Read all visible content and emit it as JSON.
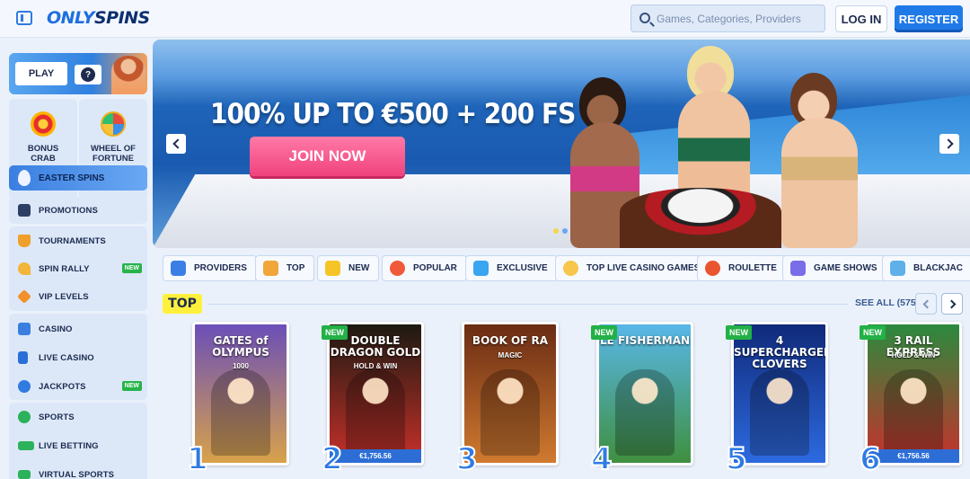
{
  "header": {
    "logo_main": "ONLY",
    "logo_accent": "SPINS",
    "search_placeholder": "Games, Categories, Providers",
    "login_label": "LOG IN",
    "register_label": "REGISTER"
  },
  "sidebar": {
    "play_label": "PLAY",
    "help_label": "?",
    "bonus_crab": "BONUS CRAB",
    "wheel_of_fortune": "WHEEL OF FORTUNE",
    "easter_spins": "EASTER SPINS",
    "group1": [
      {
        "label": "PROMOTIONS",
        "icon": "gift-icon"
      }
    ],
    "group2": [
      {
        "label": "TOURNAMENTS",
        "icon": "trophy-icon"
      },
      {
        "label": "SPIN RALLY",
        "icon": "pizza-icon",
        "badge": "NEW"
      },
      {
        "label": "VIP LEVELS",
        "icon": "diamond-icon"
      }
    ],
    "group3": [
      {
        "label": "CASINO",
        "icon": "slot-machine-icon"
      },
      {
        "label": "LIVE CASINO",
        "icon": "cards-icon"
      },
      {
        "label": "JACKPOTS",
        "icon": "clover-icon",
        "badge": "NEW"
      }
    ],
    "group4": [
      {
        "label": "SPORTS",
        "icon": "soccer-ball-icon"
      },
      {
        "label": "LIVE BETTING",
        "icon": "live-icon"
      },
      {
        "label": "VIRTUAL SPORTS",
        "icon": "virtual-icon"
      }
    ]
  },
  "banner": {
    "title": "100% UP TO €500 + 200 FS",
    "cta": "JOIN NOW"
  },
  "categories": [
    {
      "label": "PROVIDERS",
      "icon": "providers-icon",
      "color": "#3b7fe6"
    },
    {
      "label": "TOP",
      "icon": "top-icon",
      "color": "#f1a63a"
    },
    {
      "label": "NEW",
      "icon": "lightning-icon",
      "color": "#f5c527"
    },
    {
      "label": "POPULAR",
      "icon": "fire-icon",
      "color": "#f05a3a"
    },
    {
      "label": "EXCLUSIVE",
      "icon": "gem-icon",
      "color": "#3aa5f0"
    },
    {
      "label": "TOP LIVE CASINO GAMES",
      "icon": "live-casino-icon",
      "color": "#f7c64a"
    },
    {
      "label": "ROULETTE",
      "icon": "roulette-icon",
      "color": "#e9552f"
    },
    {
      "label": "GAME SHOWS",
      "icon": "game-shows-icon",
      "color": "#7a6de8"
    },
    {
      "label": "BLACKJAC",
      "icon": "blackjack-icon",
      "color": "#5fb0e8"
    }
  ],
  "top_section": {
    "badge": "TOP",
    "see_all": "SEE ALL (575)"
  },
  "games": [
    {
      "rank": "1",
      "title": "GATES of OLYMPUS",
      "subtitle": "1000",
      "new": "",
      "jackpot": "",
      "colors": [
        "#6b4fb8",
        "#d8a24a"
      ]
    },
    {
      "rank": "2",
      "title": "DOUBLE DRAGON GOLD",
      "subtitle": "HOLD & WIN",
      "new": "NEW",
      "jackpot": "€1,756.56",
      "colors": [
        "#1c1a12",
        "#c8302a"
      ]
    },
    {
      "rank": "3",
      "title": "BOOK OF RA",
      "subtitle": "MAGIC",
      "new": "",
      "jackpot": "",
      "colors": [
        "#6a2c14",
        "#d07a30"
      ]
    },
    {
      "rank": "4",
      "title": "LE FISHERMAN",
      "subtitle": "",
      "new": "NEW",
      "jackpot": "",
      "colors": [
        "#58b7e8",
        "#3f8f3f"
      ]
    },
    {
      "rank": "5",
      "title": "4 SUPERCHARGED CLOVERS",
      "subtitle": "",
      "new": "NEW",
      "jackpot": "",
      "colors": [
        "#102a7a",
        "#2d6ae0"
      ]
    },
    {
      "rank": "6",
      "title": "3 RAIL EXPRESS",
      "subtitle": "HOLD & WIN",
      "new": "NEW",
      "jackpot": "€1,756.56",
      "colors": [
        "#2b8a3e",
        "#c9302c"
      ]
    }
  ]
}
